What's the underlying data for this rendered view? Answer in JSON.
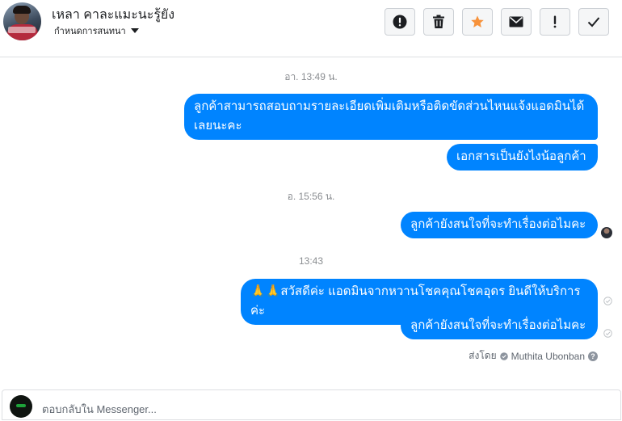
{
  "header": {
    "contact_name": "เหลา คาละแมะนะรู้ยัง",
    "subtitle": "กำหนดการสนทนา",
    "toolbar": [
      {
        "name": "spam",
        "icon": "exclamation-circle-icon"
      },
      {
        "name": "delete",
        "icon": "trash-icon"
      },
      {
        "name": "star",
        "icon": "star-icon",
        "color": "#f7923b"
      },
      {
        "name": "mark-unread",
        "icon": "envelope-icon"
      },
      {
        "name": "follow-up",
        "icon": "exclamation-icon"
      },
      {
        "name": "done",
        "icon": "checkmark-icon"
      }
    ]
  },
  "conversation": {
    "timestamps": [
      "อา. 13:49 น.",
      "อ. 15:56 น.",
      "13:43"
    ],
    "messages": [
      {
        "text": "ลูกค้าสามารถสอบถามรายละเอียดเพิ่มเติมหรือติดขัดส่วนไหนแจ้งแอดมินได้เลยนะคะ"
      },
      {
        "text": "เอกสารเป็นยังไงน้อลูกค้า"
      },
      {
        "text": "ลูกค้ายังสนใจที่จะทำเรื่องต่อไมคะ"
      },
      {
        "text": "🙏🙏สวัสดีค่ะ แอดมินจากหวานโชคคุณโชคอุดร ยินดีให้บริการค่ะ"
      },
      {
        "text": "ลูกค้ายังสนใจที่จะทำเรื่องต่อไมคะ"
      }
    ],
    "sent_by_prefix": "ส่งโดย",
    "sent_by_name": "Muthita Ubonban",
    "bubble_color": "#0084ff"
  },
  "composer": {
    "placeholder": "ตอบกลับใน Messenger..."
  }
}
